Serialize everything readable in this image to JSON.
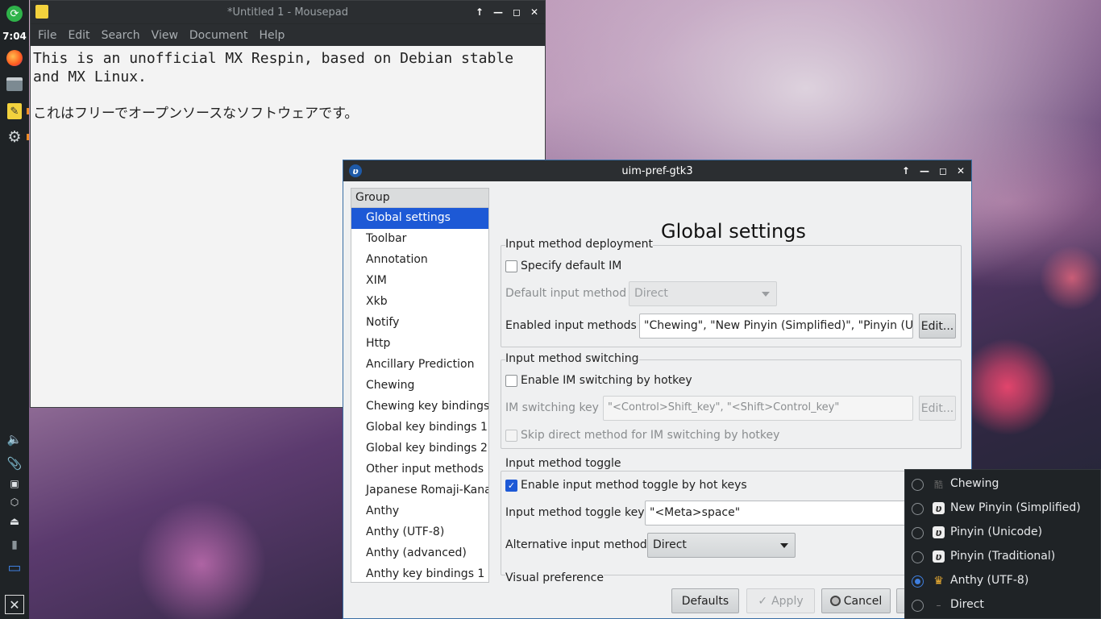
{
  "panel": {
    "clock": "7:04"
  },
  "mousepad": {
    "title": "*Untitled 1 - Mousepad",
    "menu": [
      "File",
      "Edit",
      "Search",
      "View",
      "Document",
      "Help"
    ],
    "text_line1": "This is an unofficial MX Respin, based on Debian stable",
    "text_line2": "and MX Linux.",
    "text_line3": "",
    "text_line4": "これはフリーでオープンソースなソフトウェアです。"
  },
  "dialog": {
    "title": "uim-pref-gtk3",
    "group_header": "Group",
    "groups": [
      "Global settings",
      "Toolbar",
      "Annotation",
      "XIM",
      "Xkb",
      "Notify",
      "Http",
      "Ancillary Prediction",
      "Chewing",
      "Chewing key bindings",
      "Global key bindings 1",
      "Global key bindings 2",
      "Other input methods",
      "Japanese Romaji-Kana",
      "Anthy",
      "Anthy (UTF-8)",
      "Anthy (advanced)",
      "Anthy key bindings 1"
    ],
    "heading": "Global settings",
    "deployment": {
      "label": "Input method deployment",
      "specify_default_im": "Specify default IM",
      "default_im_label": "Default input method",
      "default_im_value": "Direct",
      "enabled_label": "Enabled input methods",
      "enabled_value": "\"Chewing\", \"New Pinyin (Simplified)\", \"Pinyin (Unicode)\", \"Pinyin (Traditional)\"",
      "edit_label": "Edit..."
    },
    "switching": {
      "label": "Input method switching",
      "enable_hotkey": "Enable IM switching by hotkey",
      "key_label": "IM switching key",
      "key_value": "\"<Control>Shift_key\", \"<Shift>Control_key\"",
      "edit_label": "Edit...",
      "skip_direct": "Skip direct method for IM switching by hotkey"
    },
    "toggle": {
      "label": "Input method toggle",
      "enable_toggle": "Enable input method toggle by hot keys",
      "key_label": "Input method toggle key",
      "key_value": "\"<Meta>space\"",
      "alt_label": "Alternative input method",
      "alt_value": "Direct"
    },
    "visual_label": "Visual preference",
    "buttons": {
      "defaults": "Defaults",
      "apply": "Apply",
      "cancel": "Cancel"
    }
  },
  "im_menu": {
    "items": [
      {
        "label": "Chewing",
        "icon": "chewing-icon",
        "selected": false
      },
      {
        "label": "New Pinyin (Simplified)",
        "icon": "pinyin-icon",
        "selected": false
      },
      {
        "label": "Pinyin (Unicode)",
        "icon": "pinyin-icon",
        "selected": false
      },
      {
        "label": "Pinyin (Traditional)",
        "icon": "pinyin-icon",
        "selected": false
      },
      {
        "label": "Anthy (UTF-8)",
        "icon": "anthy-crown-icon",
        "selected": true
      },
      {
        "label": "Direct",
        "icon": "direct-icon",
        "selected": false
      }
    ]
  },
  "colors": {
    "selection": "#1d59d6",
    "titlebar": "#2b2e31",
    "panel": "#1f2326"
  }
}
